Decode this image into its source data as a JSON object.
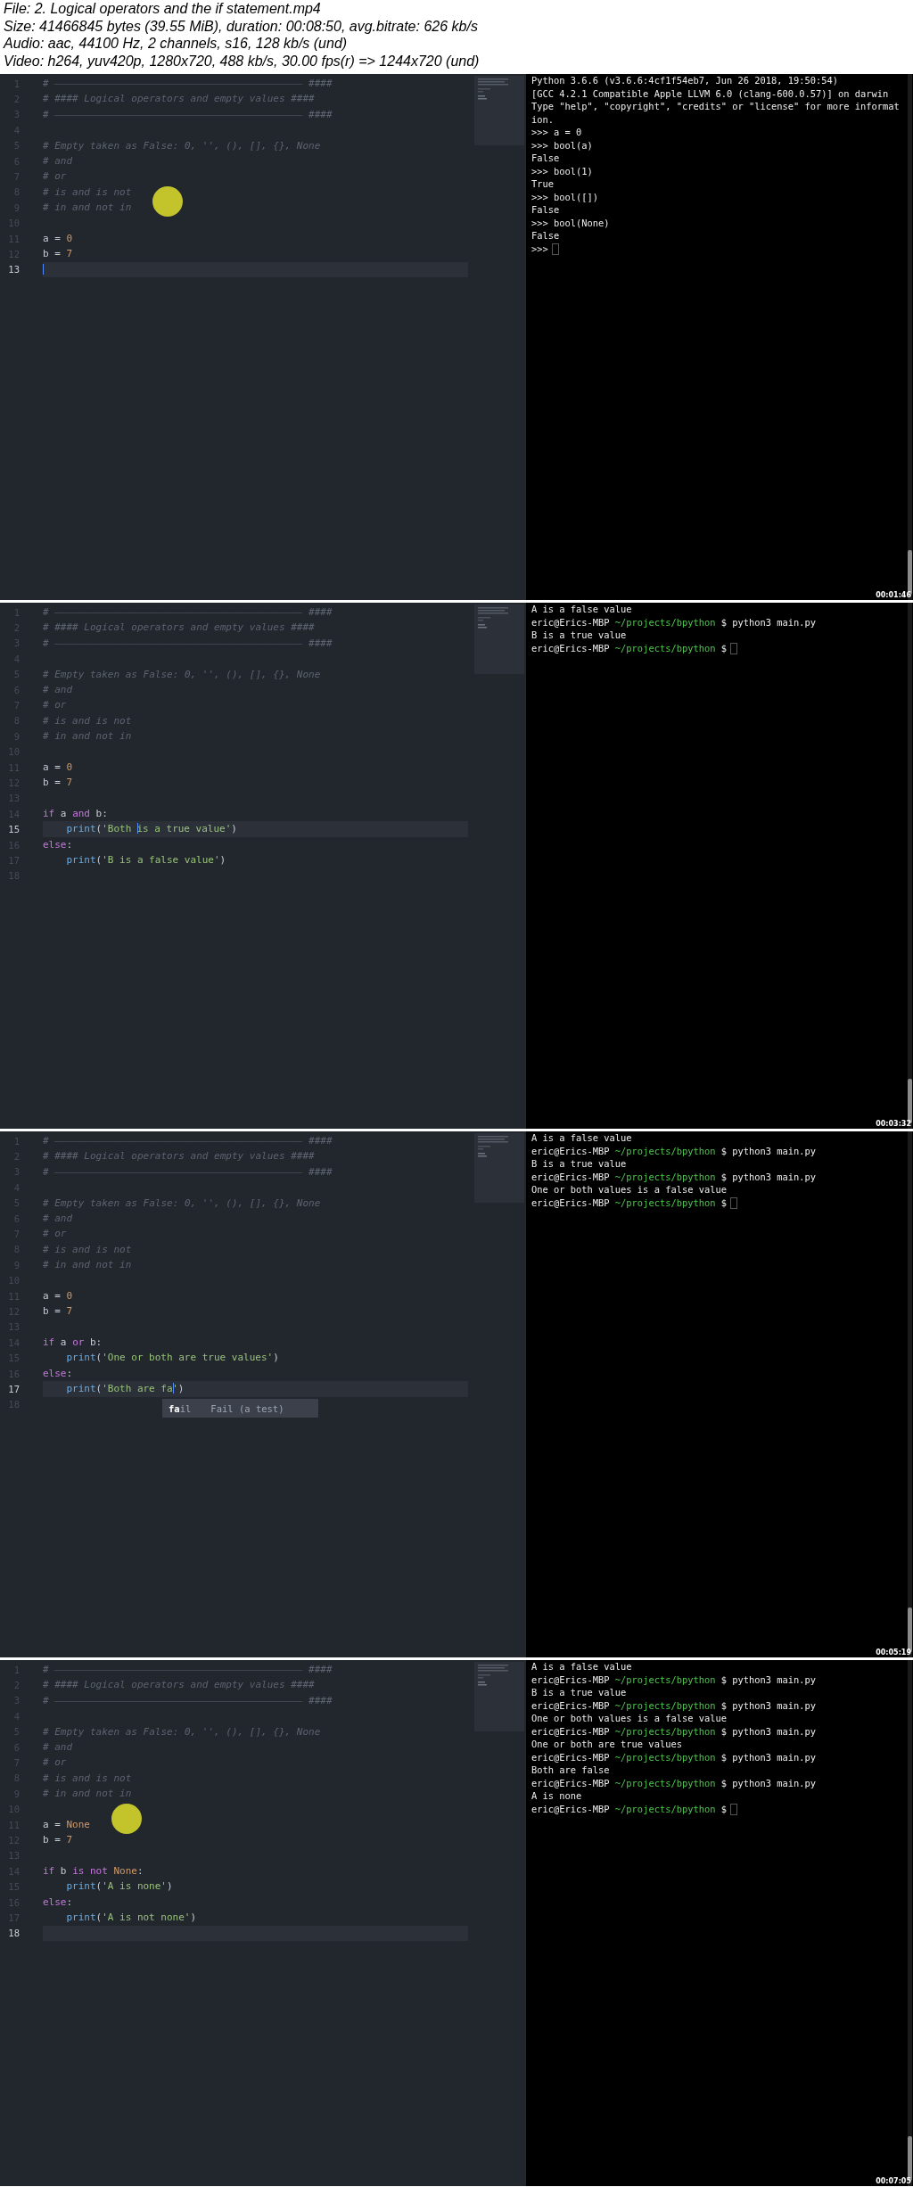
{
  "header": {
    "lines": [
      "File: 2. Logical operators and the if statement.mp4",
      "Size: 41466845 bytes (39.55 MiB), duration: 00:08:50, avg.bitrate: 626 kb/s",
      "Audio: aac, 44100 Hz, 2 channels, s16, 128 kb/s (und)",
      "Video: h264, yuv420p, 1280x720, 488 kb/s, 30.00 fps(r) => 1244x720 (und)"
    ]
  },
  "frames": [
    {
      "timestamp": "00:01:46",
      "editor": {
        "lines": [
          {
            "number": "1",
            "current": false,
            "tokens": [
              {
                "kind": "comment",
                "text": "# —————————————————————————————————————————— ####"
              }
            ]
          },
          {
            "number": "2",
            "current": false,
            "tokens": [
              {
                "kind": "comment",
                "text": "# #### Logical operators and empty values ####"
              }
            ]
          },
          {
            "number": "3",
            "current": false,
            "tokens": [
              {
                "kind": "comment",
                "text": "# —————————————————————————————————————————— ####"
              }
            ]
          },
          {
            "number": "4",
            "current": false
          },
          {
            "number": "5",
            "current": false,
            "tokens": [
              {
                "kind": "comment",
                "text": "# Empty taken as False: 0, '', (), [], {}, None"
              }
            ]
          },
          {
            "number": "6",
            "current": false,
            "tokens": [
              {
                "kind": "comment",
                "text": "# and"
              }
            ]
          },
          {
            "number": "7",
            "current": false,
            "tokens": [
              {
                "kind": "comment",
                "text": "# or"
              }
            ]
          },
          {
            "number": "8",
            "current": false,
            "tokens": [
              {
                "kind": "comment",
                "text": "# is and is not"
              }
            ]
          },
          {
            "number": "9",
            "current": false,
            "tokens": [
              {
                "kind": "comment",
                "text": "# in and not in"
              },
              {
                "kind": "pointer"
              }
            ]
          },
          {
            "number": "10",
            "current": false
          },
          {
            "number": "11",
            "current": false,
            "tokens": [
              {
                "kind": "plain",
                "text": "a = "
              },
              {
                "kind": "number",
                "text": "0"
              }
            ]
          },
          {
            "number": "12",
            "current": false,
            "tokens": [
              {
                "kind": "plain",
                "text": "b = "
              },
              {
                "kind": "number",
                "text": "7"
              }
            ]
          },
          {
            "number": "13",
            "current": true,
            "tokens": [
              {
                "kind": "caret"
              }
            ]
          }
        ]
      },
      "terminal": {
        "cursor": true,
        "lines": [
          {
            "kind": "output",
            "text": "Python 3.6.6 (v3.6.6:4cf1f54eb7, Jun 26 2018, 19:50:54)"
          },
          {
            "kind": "output",
            "text": "[GCC 4.2.1 Compatible Apple LLVM 6.0 (clang-600.0.57)] on darwin"
          },
          {
            "kind": "output",
            "text": "Type \"help\", \"copyright\", \"credits\" or \"license\" for more informat"
          },
          {
            "kind": "output",
            "text": "ion."
          },
          {
            "kind": "output",
            "text": ">>> a = 0"
          },
          {
            "kind": "output",
            "text": ">>> bool(a)"
          },
          {
            "kind": "output",
            "text": "False"
          },
          {
            "kind": "output",
            "text": ">>> bool(1)"
          },
          {
            "kind": "output",
            "text": "True"
          },
          {
            "kind": "output",
            "text": ">>> bool([])"
          },
          {
            "kind": "output",
            "text": "False"
          },
          {
            "kind": "output",
            "text": ">>> bool(None)"
          },
          {
            "kind": "output",
            "text": "False"
          },
          {
            "kind": "output",
            "text": ">>>"
          }
        ]
      }
    },
    {
      "timestamp": "00:03:32",
      "editor": {
        "lines": [
          {
            "number": "1",
            "current": false,
            "tokens": [
              {
                "kind": "comment",
                "text": "# —————————————————————————————————————————— ####"
              }
            ]
          },
          {
            "number": "2",
            "current": false,
            "tokens": [
              {
                "kind": "comment",
                "text": "# #### Logical operators and empty values ####"
              }
            ]
          },
          {
            "number": "3",
            "current": false,
            "tokens": [
              {
                "kind": "comment",
                "text": "# —————————————————————————————————————————— ####"
              }
            ]
          },
          {
            "number": "4",
            "current": false
          },
          {
            "number": "5",
            "current": false,
            "tokens": [
              {
                "kind": "comment",
                "text": "# Empty taken as False: 0, '', (), [], {}, None"
              }
            ]
          },
          {
            "number": "6",
            "current": false,
            "tokens": [
              {
                "kind": "comment",
                "text": "# and"
              }
            ]
          },
          {
            "number": "7",
            "current": false,
            "tokens": [
              {
                "kind": "comment",
                "text": "# or"
              }
            ]
          },
          {
            "number": "8",
            "current": false,
            "tokens": [
              {
                "kind": "comment",
                "text": "# is and is not"
              }
            ]
          },
          {
            "number": "9",
            "current": false,
            "tokens": [
              {
                "kind": "comment",
                "text": "# in and not in"
              }
            ]
          },
          {
            "number": "10",
            "current": false
          },
          {
            "number": "11",
            "current": false,
            "tokens": [
              {
                "kind": "plain",
                "text": "a = "
              },
              {
                "kind": "number",
                "text": "0"
              }
            ]
          },
          {
            "number": "12",
            "current": false,
            "tokens": [
              {
                "kind": "plain",
                "text": "b = "
              },
              {
                "kind": "number",
                "text": "7"
              }
            ]
          },
          {
            "number": "13",
            "current": false
          },
          {
            "number": "14",
            "current": false,
            "tokens": [
              {
                "kind": "keyword",
                "text": "if"
              },
              {
                "kind": "plain",
                "text": " a "
              },
              {
                "kind": "keyword",
                "text": "and"
              },
              {
                "kind": "plain",
                "text": " b:"
              }
            ]
          },
          {
            "number": "15",
            "current": true,
            "indent": true,
            "tokens": [
              {
                "kind": "function",
                "text": "print"
              },
              {
                "kind": "plain",
                "text": "("
              },
              {
                "kind": "string",
                "text": "'Both "
              },
              {
                "kind": "caret"
              },
              {
                "kind": "string",
                "text": "is a true value'"
              },
              {
                "kind": "plain",
                "text": ")"
              }
            ]
          },
          {
            "number": "16",
            "current": false,
            "tokens": [
              {
                "kind": "keyword",
                "text": "else"
              },
              {
                "kind": "plain",
                "text": ":"
              }
            ]
          },
          {
            "number": "17",
            "current": false,
            "indent": true,
            "tokens": [
              {
                "kind": "function",
                "text": "print"
              },
              {
                "kind": "plain",
                "text": "("
              },
              {
                "kind": "string",
                "text": "'B is a false value'"
              },
              {
                "kind": "plain",
                "text": ")"
              }
            ]
          },
          {
            "number": "18",
            "current": false
          }
        ]
      },
      "terminal": {
        "cursor": true,
        "lines": [
          {
            "kind": "output",
            "text": "A is a false value"
          },
          {
            "kind": "prompt",
            "user": "eric@Erics-MBP",
            "path": "~/projects/bpython",
            "symbol": "$",
            "command": "python3 main.py"
          },
          {
            "kind": "output",
            "text": "B is a true value"
          },
          {
            "kind": "prompt",
            "user": "eric@Erics-MBP",
            "path": "~/projects/bpython",
            "symbol": "$"
          }
        ]
      }
    },
    {
      "timestamp": "00:05:19",
      "editor": {
        "lines": [
          {
            "number": "1",
            "current": false,
            "tokens": [
              {
                "kind": "comment",
                "text": "# —————————————————————————————————————————— ####"
              }
            ]
          },
          {
            "number": "2",
            "current": false,
            "tokens": [
              {
                "kind": "comment",
                "text": "# #### Logical operators and empty values ####"
              }
            ]
          },
          {
            "number": "3",
            "current": false,
            "tokens": [
              {
                "kind": "comment",
                "text": "# —————————————————————————————————————————— ####"
              }
            ]
          },
          {
            "number": "4",
            "current": false
          },
          {
            "number": "5",
            "current": false,
            "tokens": [
              {
                "kind": "comment",
                "text": "# Empty taken as False: 0, '', (), [], {}, None"
              }
            ]
          },
          {
            "number": "6",
            "current": false,
            "tokens": [
              {
                "kind": "comment",
                "text": "# and"
              }
            ]
          },
          {
            "number": "7",
            "current": false,
            "tokens": [
              {
                "kind": "comment",
                "text": "# or"
              }
            ]
          },
          {
            "number": "8",
            "current": false,
            "tokens": [
              {
                "kind": "comment",
                "text": "# is and is not"
              }
            ]
          },
          {
            "number": "9",
            "current": false,
            "tokens": [
              {
                "kind": "comment",
                "text": "# in and not in"
              }
            ]
          },
          {
            "number": "10",
            "current": false
          },
          {
            "number": "11",
            "current": false,
            "tokens": [
              {
                "kind": "plain",
                "text": "a = "
              },
              {
                "kind": "number",
                "text": "0"
              }
            ]
          },
          {
            "number": "12",
            "current": false,
            "tokens": [
              {
                "kind": "plain",
                "text": "b = "
              },
              {
                "kind": "number",
                "text": "7"
              }
            ]
          },
          {
            "number": "13",
            "current": false
          },
          {
            "number": "14",
            "current": false,
            "tokens": [
              {
                "kind": "keyword",
                "text": "if"
              },
              {
                "kind": "plain",
                "text": " a "
              },
              {
                "kind": "keyword",
                "text": "or"
              },
              {
                "kind": "plain",
                "text": " b:"
              }
            ]
          },
          {
            "number": "15",
            "current": false,
            "indent": true,
            "tokens": [
              {
                "kind": "function",
                "text": "print"
              },
              {
                "kind": "plain",
                "text": "("
              },
              {
                "kind": "string",
                "text": "'One or both are true values'"
              },
              {
                "kind": "plain",
                "text": ")"
              }
            ]
          },
          {
            "number": "16",
            "current": false,
            "tokens": [
              {
                "kind": "keyword",
                "text": "else"
              },
              {
                "kind": "plain",
                "text": ":"
              }
            ]
          },
          {
            "number": "17",
            "current": true,
            "indent": true,
            "tokens": [
              {
                "kind": "function",
                "text": "print"
              },
              {
                "kind": "plain",
                "text": "("
              },
              {
                "kind": "string",
                "text": "'Both are fa"
              },
              {
                "kind": "caret"
              },
              {
                "kind": "string",
                "text": "'"
              },
              {
                "kind": "plain",
                "text": ")"
              }
            ]
          },
          {
            "number": "18",
            "current": false
          }
        ],
        "popup": {
          "suggestion": "**fa**il",
          "description": "Fail (a test)"
        }
      },
      "terminal": {
        "cursor": true,
        "lines": [
          {
            "kind": "output",
            "text": "A is a false value"
          },
          {
            "kind": "prompt",
            "user": "eric@Erics-MBP",
            "path": "~/projects/bpython",
            "symbol": "$",
            "command": "python3 main.py"
          },
          {
            "kind": "output",
            "text": "B is a true value"
          },
          {
            "kind": "prompt",
            "user": "eric@Erics-MBP",
            "path": "~/projects/bpython",
            "symbol": "$",
            "command": "python3 main.py"
          },
          {
            "kind": "output",
            "text": "One or both values is a false value"
          },
          {
            "kind": "prompt",
            "user": "eric@Erics-MBP",
            "path": "~/projects/bpython",
            "symbol": "$"
          }
        ]
      }
    },
    {
      "timestamp": "00:07:05",
      "editor": {
        "lines": [
          {
            "number": "1",
            "current": false,
            "tokens": [
              {
                "kind": "comment",
                "text": "# —————————————————————————————————————————— ####"
              }
            ]
          },
          {
            "number": "2",
            "current": false,
            "tokens": [
              {
                "kind": "comment",
                "text": "# #### Logical operators and empty values ####"
              }
            ]
          },
          {
            "number": "3",
            "current": false,
            "tokens": [
              {
                "kind": "comment",
                "text": "# —————————————————————————————————————————— ####"
              }
            ]
          },
          {
            "number": "4",
            "current": false
          },
          {
            "number": "5",
            "current": false,
            "tokens": [
              {
                "kind": "comment",
                "text": "# Empty taken as False: 0, '', (), [], {}, None"
              }
            ]
          },
          {
            "number": "6",
            "current": false,
            "tokens": [
              {
                "kind": "comment",
                "text": "# and"
              }
            ]
          },
          {
            "number": "7",
            "current": false,
            "tokens": [
              {
                "kind": "comment",
                "text": "# or"
              }
            ]
          },
          {
            "number": "8",
            "current": false,
            "tokens": [
              {
                "kind": "comment",
                "text": "# is and is not"
              }
            ]
          },
          {
            "number": "9",
            "current": false,
            "tokens": [
              {
                "kind": "comment",
                "text": "# in and not in"
              }
            ]
          },
          {
            "number": "10",
            "current": false
          },
          {
            "number": "11",
            "current": false,
            "tokens": [
              {
                "kind": "plain",
                "text": "a = "
              },
              {
                "kind": "constant",
                "text": "None"
              },
              {
                "kind": "pointer"
              }
            ]
          },
          {
            "number": "12",
            "current": false,
            "tokens": [
              {
                "kind": "plain",
                "text": "b = "
              },
              {
                "kind": "number",
                "text": "7"
              }
            ]
          },
          {
            "number": "13",
            "current": false
          },
          {
            "number": "14",
            "current": false,
            "tokens": [
              {
                "kind": "keyword",
                "text": "if"
              },
              {
                "kind": "plain",
                "text": " b "
              },
              {
                "kind": "keyword",
                "text": "is not "
              },
              {
                "kind": "constant",
                "text": "None"
              },
              {
                "kind": "plain",
                "text": ":"
              }
            ]
          },
          {
            "number": "15",
            "current": false,
            "indent": true,
            "tokens": [
              {
                "kind": "function",
                "text": "print"
              },
              {
                "kind": "plain",
                "text": "("
              },
              {
                "kind": "string",
                "text": "'A is none'"
              },
              {
                "kind": "plain",
                "text": ")"
              }
            ]
          },
          {
            "number": "16",
            "current": false,
            "tokens": [
              {
                "kind": "keyword",
                "text": "else"
              },
              {
                "kind": "plain",
                "text": ":"
              }
            ]
          },
          {
            "number": "17",
            "current": false,
            "indent": true,
            "tokens": [
              {
                "kind": "function",
                "text": "print"
              },
              {
                "kind": "plain",
                "text": "("
              },
              {
                "kind": "string",
                "text": "'A is not none'"
              },
              {
                "kind": "plain",
                "text": ")"
              }
            ]
          },
          {
            "number": "18",
            "current": true
          }
        ]
      },
      "terminal": {
        "cursor": true,
        "lines": [
          {
            "kind": "output",
            "text": "A is a false value"
          },
          {
            "kind": "prompt",
            "user": "eric@Erics-MBP",
            "path": "~/projects/bpython",
            "symbol": "$",
            "command": "python3 main.py"
          },
          {
            "kind": "output",
            "text": "B is a true value"
          },
          {
            "kind": "prompt",
            "user": "eric@Erics-MBP",
            "path": "~/projects/bpython",
            "symbol": "$",
            "command": "python3 main.py"
          },
          {
            "kind": "output",
            "text": "One or both values is a false value"
          },
          {
            "kind": "prompt",
            "user": "eric@Erics-MBP",
            "path": "~/projects/bpython",
            "symbol": "$",
            "command": "python3 main.py"
          },
          {
            "kind": "output",
            "text": "One or both are true values"
          },
          {
            "kind": "prompt",
            "user": "eric@Erics-MBP",
            "path": "~/projects/bpython",
            "symbol": "$",
            "command": "python3 main.py"
          },
          {
            "kind": "output",
            "text": "Both are false"
          },
          {
            "kind": "prompt",
            "user": "eric@Erics-MBP",
            "path": "~/projects/bpython",
            "symbol": "$",
            "command": "python3 main.py"
          },
          {
            "kind": "output",
            "text": "A is none"
          },
          {
            "kind": "prompt",
            "user": "eric@Erics-MBP",
            "path": "~/projects/bpython",
            "symbol": "$"
          }
        ]
      }
    }
  ]
}
